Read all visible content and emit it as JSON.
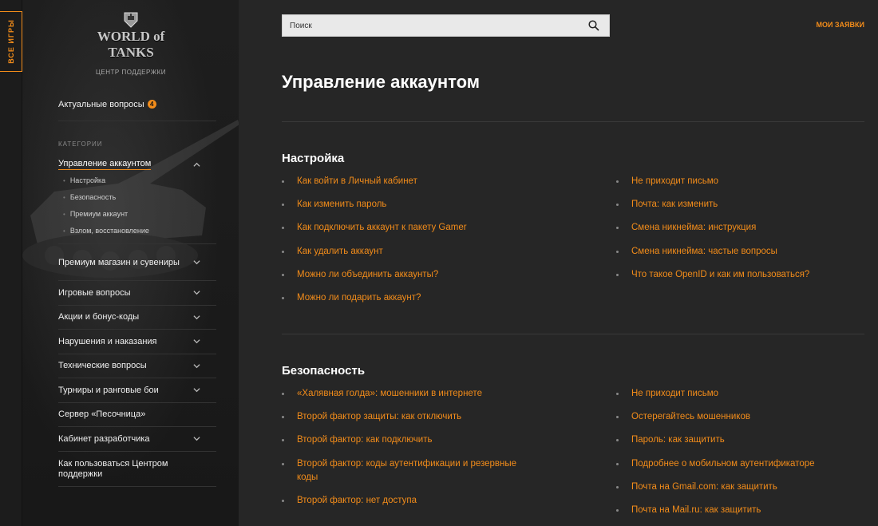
{
  "games_tab": {
    "label": "ВСЕ ИГРЫ"
  },
  "brand": {
    "wordmark": "WORLD of TANKS",
    "subtitle": "ЦЕНТР ПОДДЕРЖКИ"
  },
  "sidebar": {
    "hot": {
      "label": "Актуальные вопросы",
      "count": "4"
    },
    "categories_title": "КАТЕГОРИИ",
    "active_category": {
      "label": "Управление аккаунтом",
      "subitems": [
        "Настройка",
        "Безопасность",
        "Премиум аккаунт",
        "Взлом, восстановление"
      ]
    },
    "categories": [
      {
        "label": "Премиум магазин и сувениры",
        "has_chevron": true
      },
      {
        "label": "Игровые вопросы",
        "has_chevron": true
      },
      {
        "label": "Акции и бонус-коды",
        "has_chevron": true
      },
      {
        "label": "Нарушения и наказания",
        "has_chevron": true
      },
      {
        "label": "Технические вопросы",
        "has_chevron": true
      },
      {
        "label": "Турниры и ранговые бои",
        "has_chevron": true
      },
      {
        "label": "Сервер «Песочница»",
        "has_chevron": false
      },
      {
        "label": "Кабинет разработчика",
        "has_chevron": true
      },
      {
        "label": "Как пользоваться Центром поддержки",
        "has_chevron": false
      }
    ]
  },
  "header": {
    "search_placeholder": "Поиск",
    "my_requests": "МОИ ЗАЯВКИ"
  },
  "main": {
    "title": "Управление аккаунтом",
    "sections": [
      {
        "title": "Настройка",
        "left": [
          "Как войти в Личный кабинет",
          "Как изменить пароль",
          "Как подключить аккаунт к пакету Gamer",
          "Как удалить аккаунт",
          "Можно ли объединить аккаунты?",
          "Можно ли подарить аккаунт?"
        ],
        "right": [
          "Не приходит письмо",
          "Почта: как изменить",
          "Смена никнейма: инструкция",
          "Смена никнейма: частые вопросы",
          "Что такое OpenID и как им пользоваться?"
        ]
      },
      {
        "title": "Безопасность",
        "left": [
          "«Халявная голда»: мошенники в интернете",
          "Второй фактор защиты: как отключить",
          "Второй фактор: как подключить",
          "Второй фактор: коды аутентификации и резервные коды",
          "Второй фактор: нет доступа"
        ],
        "right": [
          "Не приходит письмо",
          "Остерегайтесь мошенников",
          "Пароль: как защитить",
          "Подробнее о мобильном аутентификаторе",
          "Почта на Gmail.com: как защитить",
          "Почта на Mail.ru: как защитить"
        ]
      }
    ]
  },
  "colors": {
    "accent": "#f28c1a",
    "background": "#262626",
    "sidebar": "#1c1c1c"
  },
  "icons": [
    "search-icon",
    "chevron-down-icon",
    "chevron-up-icon",
    "tank-emblem-icon"
  ]
}
